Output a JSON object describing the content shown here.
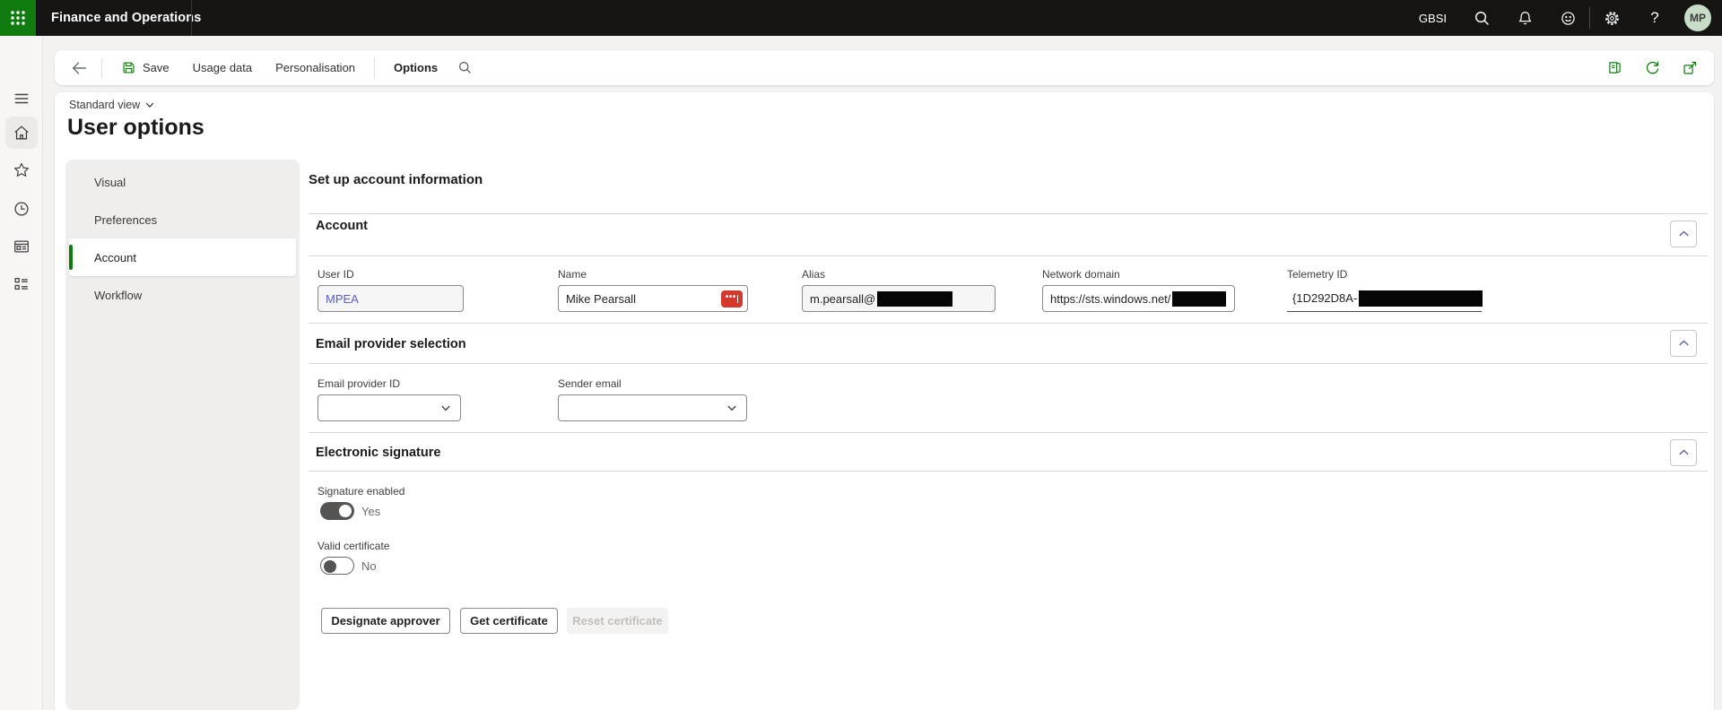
{
  "topbar": {
    "app_title": "Finance and Operations",
    "environment": "GBSI",
    "help_glyph": "?",
    "avatar_initials": "MP"
  },
  "actionbar": {
    "save": "Save",
    "usage_data": "Usage data",
    "personalisation": "Personalisation",
    "options_tab": "Options"
  },
  "header": {
    "view_selector": "Standard view",
    "page_title": "User options"
  },
  "nav": {
    "items": [
      {
        "label": "Visual",
        "selected": false
      },
      {
        "label": "Preferences",
        "selected": false
      },
      {
        "label": "Account",
        "selected": true
      },
      {
        "label": "Workflow",
        "selected": false
      }
    ]
  },
  "content": {
    "heading": "Set up account information",
    "account": {
      "title": "Account",
      "user_id": {
        "label": "User ID",
        "value": "MPEA",
        "disabled": true
      },
      "name": {
        "label": "Name",
        "value": "Mike Pearsall"
      },
      "alias": {
        "label": "Alias",
        "value": "m.pearsall@",
        "redacted": true,
        "disabled": true
      },
      "network_domain": {
        "label": "Network domain",
        "value": "https://sts.windows.net/",
        "redacted": true
      },
      "telemetry_id": {
        "label": "Telemetry ID",
        "value": "{1D292D8A-",
        "redacted": true
      }
    },
    "email": {
      "title": "Email provider selection",
      "provider_id": {
        "label": "Email provider ID",
        "value": ""
      },
      "sender_email": {
        "label": "Sender email",
        "value": ""
      }
    },
    "signature": {
      "title": "Electronic signature",
      "signature_enabled": {
        "label": "Signature enabled",
        "state": "Yes",
        "on": true
      },
      "valid_certificate": {
        "label": "Valid certificate",
        "state": "No",
        "on": false
      },
      "buttons": {
        "designate_approver": {
          "label": "Designate approver",
          "disabled": false
        },
        "get_certificate": {
          "label": "Get certificate",
          "disabled": false
        },
        "reset_certificate": {
          "label": "Reset certificate",
          "disabled": true
        }
      }
    }
  },
  "icons": {
    "topbar": [
      "app-launcher-grid",
      "search",
      "bell",
      "smiley-feedback",
      "gear",
      "help-question",
      "avatar"
    ],
    "actionbar": [
      "back-arrow",
      "save-floppy",
      "search",
      "office-panel",
      "refresh",
      "open-new-window"
    ],
    "rail": [
      "hamburger-menu",
      "home",
      "favorites-star",
      "recent-clock",
      "workspaces-window",
      "forms-list"
    ],
    "field_addons": [
      "lastpass-ellipsis-badge",
      "combo-chevron-down",
      "section-chevron-up",
      "view-chevron-down"
    ]
  },
  "colors": {
    "topbar_bg": "#161514",
    "accent_green": "#107c10",
    "link_blue": "#5b5fc7",
    "badge_red": "#d4372b",
    "page_bg": "#f4f2f0",
    "nav_panel_bg": "#f0eeec",
    "divider": "#d8d6d4",
    "toggle_on": "#555453",
    "avatar_bg": "#c7ddc7",
    "redaction": "#050505"
  }
}
